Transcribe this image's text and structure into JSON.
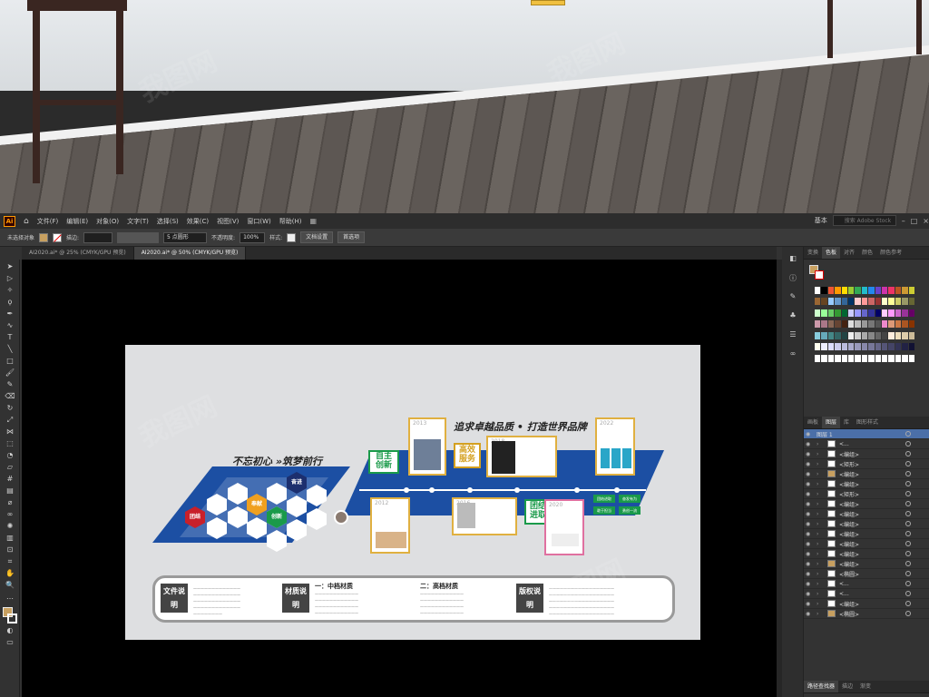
{
  "app": {
    "logo": "Ai"
  },
  "menu": [
    "文件(F)",
    "编辑(E)",
    "对象(O)",
    "文字(T)",
    "选择(S)",
    "效果(C)",
    "视图(V)",
    "窗口(W)",
    "帮助(H)"
  ],
  "menu_right": {
    "workspace": "基本",
    "search_placeholder": "搜索 Adobe Stock"
  },
  "control": {
    "selection": "未选择对象",
    "stroke_label": "描边:",
    "stroke_size": "5 点圆形",
    "opacity_label": "不透明度:",
    "opacity": "100%",
    "style_label": "样式:",
    "doc_setup": "文档设置",
    "prefs": "首选项"
  },
  "tabs": [
    "AI2020.ai* @ 25% (CMYK/GPU 预览)",
    "AI2020.ai* @ 50% (CMYK/GPU 预览)"
  ],
  "panel_tabs_top": [
    "变换",
    "色板",
    "对齐",
    "颜色",
    "颜色参考"
  ],
  "panel_tabs_layers": [
    "画板",
    "图层",
    "库",
    "图形样式"
  ],
  "layers": {
    "top": "图层 1",
    "rows": [
      "<...",
      "<编组>",
      "<矩形>",
      "<编组>",
      "<编组>",
      "<矩形>",
      "<编组>",
      "<编组>",
      "<编组>",
      "<编组>",
      "<编组>",
      "<编组>",
      "<编组>",
      "<椭圆>",
      "<...",
      "<...",
      "<编组>",
      "<椭圆>"
    ]
  },
  "pathfinder": {
    "tabs": [
      "路径查找器",
      "描边",
      "渐变"
    ],
    "shape_mode": "形状模式:",
    "pathfinders": "路径查找器:",
    "expand": "扩展"
  },
  "design": {
    "slogan_left": "不忘初心 »筑梦前行",
    "slogan_right": "追求卓越品质 • 打造世界品牌",
    "hex_labels": [
      "团结",
      "奉献",
      "奋进",
      "创新"
    ],
    "tags": [
      "自主创新",
      "高效服务",
      "团结进取"
    ],
    "years": [
      "2013",
      "2018",
      "2022",
      "2012",
      "2016",
      "2020"
    ],
    "pills": [
      "团结进取",
      "奋发有为",
      "敢于担当",
      "勇创一流"
    ],
    "info": {
      "b1": "文件说明",
      "b2": "材质说明",
      "b3": "版权说明",
      "h1": "一：中档材质",
      "h2": "二：高档材质"
    }
  }
}
